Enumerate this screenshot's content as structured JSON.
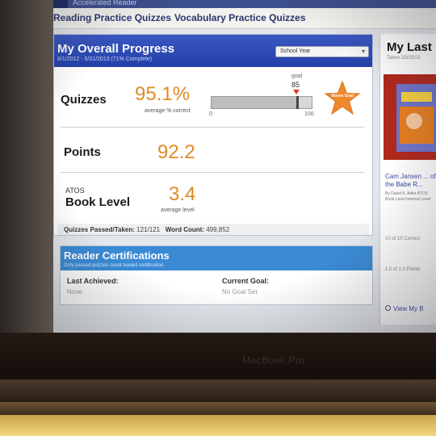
{
  "app": {
    "name": "Accelerated Reader"
  },
  "nav": {
    "tabs": [
      {
        "label": "Reading Practice Quizzes"
      },
      {
        "label": "Vocabulary Practice Quizzes"
      }
    ]
  },
  "progress": {
    "title": "My Overall Progress",
    "period_range": "8/1/2012 - 5/31/2013 (71% Complete)",
    "period_select": "School Year",
    "quizzes": {
      "label": "Quizzes",
      "value": "95.1%",
      "caption": "average % correct",
      "goal_label": "goal",
      "goal_value": "85",
      "axis_min": "0",
      "axis_max": "100",
      "current_fraction": 0.951,
      "goal_fraction": 0.85,
      "badge_text": "Above Goal"
    },
    "points": {
      "label": "Points",
      "value": "92.2"
    },
    "book_level": {
      "label_small": "ATOS",
      "label": "Book Level",
      "value": "3.4",
      "caption": "average level"
    },
    "footer": {
      "passed_label": "Quizzes Passed/Taken:",
      "passed_value": "121/121",
      "word_label": "Word Count:",
      "word_value": "499,852"
    }
  },
  "certifications": {
    "title": "Reader Certifications",
    "subtitle": "Only passed quizzes count toward certification.",
    "last_label": "Last Achieved:",
    "last_value": "None",
    "goal_label": "Current Goal:",
    "goal_value": "No Goal Set"
  },
  "sidebar": {
    "title": "My Last",
    "date": "Taken 2/3/2013",
    "book_title": "Cam Jansen ... of the Babe R...",
    "book_meta": "By David A. Adler ATOS Book Level Interest Level",
    "stat1": "10 of 10 Correct",
    "stat2": "1.0 of 1.0 Points",
    "view_link": "View My B"
  },
  "device": {
    "brand": "MacBook Pro"
  },
  "colors": {
    "header_blue": "#2340a8",
    "cert_blue": "#3a8ad4",
    "value_orange": "#e08a22",
    "badge_orange": "#ef8a2c",
    "goal_red": "#e03b2a"
  }
}
